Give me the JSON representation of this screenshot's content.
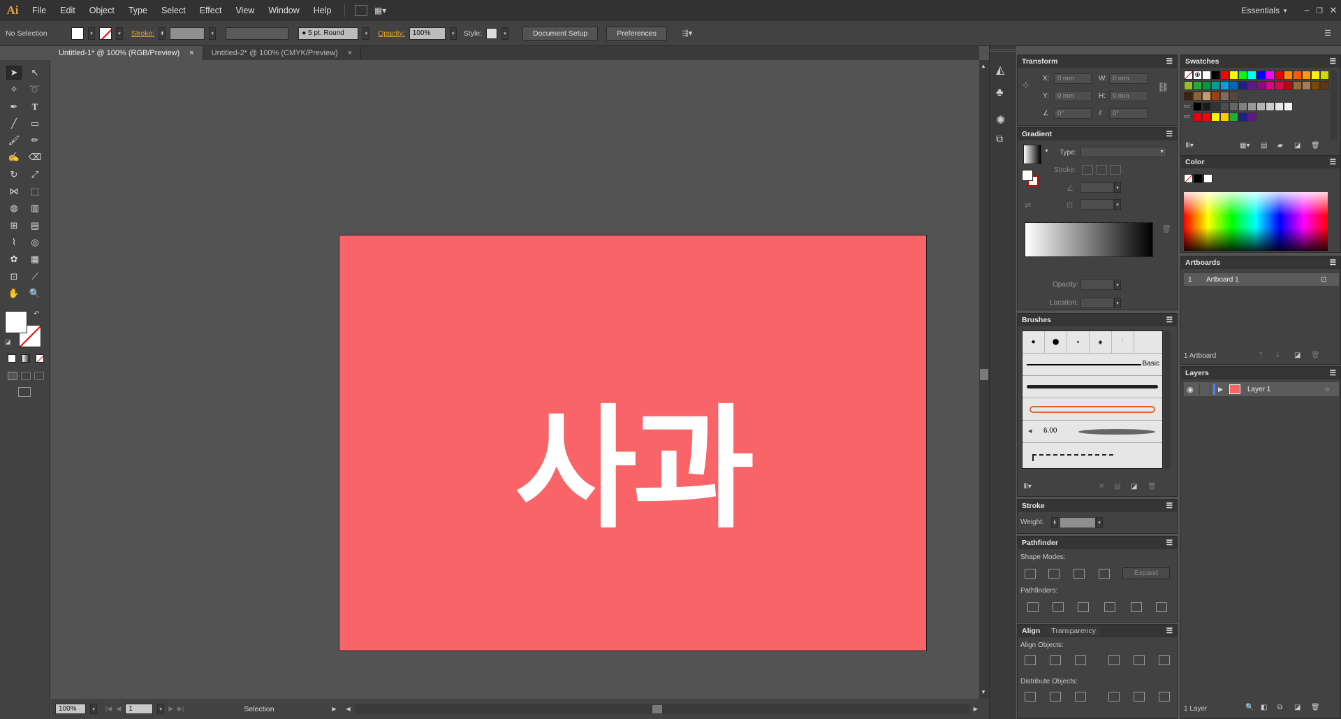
{
  "app": {
    "logo": "Ai",
    "menus": [
      "File",
      "Edit",
      "Object",
      "Type",
      "Select",
      "Effect",
      "View",
      "Window",
      "Help"
    ],
    "workspace": "Essentials",
    "window_controls": [
      "minimize",
      "restore",
      "close"
    ]
  },
  "control_bar": {
    "selection": "No Selection",
    "stroke_label": "Stroke:",
    "brush": "5 pt. Round",
    "opacity_label": "Opacity:",
    "opacity_value": "100%",
    "style_label": "Style:",
    "document_setup": "Document Setup",
    "preferences": "Preferences"
  },
  "tabs": [
    {
      "label": "Untitled-1* @ 100% (RGB/Preview)",
      "active": true,
      "close": "×"
    },
    {
      "label": "Untitled-2* @ 100% (CMYK/Preview)",
      "active": false,
      "close": "×"
    }
  ],
  "artboard": {
    "text": "사과",
    "color": "#f86467"
  },
  "status": {
    "zoom": "100%",
    "page": "1",
    "tool": "Selection"
  },
  "panels": {
    "transform": {
      "title": "Transform",
      "x_label": "X:",
      "y_label": "Y:",
      "w_label": "W:",
      "h_label": "H:",
      "x": "0 mm",
      "y": "0 mm",
      "w": "0 mm",
      "h": "0 mm",
      "angle": "0°",
      "shear": "0°"
    },
    "gradient": {
      "title": "Gradient",
      "type_label": "Type:",
      "stroke_label": "Stroke:",
      "opacity_label": "Opacity:",
      "location_label": "Location:"
    },
    "brushes": {
      "title": "Brushes",
      "basic_label": "Basic",
      "size_value": "6.00"
    },
    "stroke": {
      "title": "Stroke",
      "weight_label": "Weight:"
    },
    "pathfinder": {
      "title": "Pathfinder",
      "shape_modes": "Shape Modes:",
      "pathfinders": "Pathfinders:",
      "expand": "Expand"
    },
    "align": {
      "title": "Align",
      "transparency_tab": "Transparency",
      "align_objects": "Align Objects:",
      "distribute_objects": "Distribute Objects:"
    },
    "swatches": {
      "title": "Swatches"
    },
    "color": {
      "title": "Color"
    },
    "artboards": {
      "title": "Artboards",
      "row_num": "1",
      "row_name": "Artboard 1",
      "footer": "1 Artboard"
    },
    "layers": {
      "title": "Layers",
      "layer_name": "Layer 1",
      "footer": "1 Layer"
    }
  },
  "swatch_colors": [
    "#ffffff",
    "#000000",
    "#ff0000",
    "#ffff00",
    "#00ff00",
    "#00ffff",
    "#0000ff",
    "#ff00ff",
    "#e60012",
    "#ff8c00",
    "#ff5a00",
    "#ff9900",
    "#fff100",
    "#cfdb00",
    "#8fc31f",
    "#22ac38",
    "#009944",
    "#009e96",
    "#00a0e9",
    "#0068b7",
    "#1d2088",
    "#601986",
    "#920783",
    "#e4007f",
    "#e5004f",
    "#c7000b",
    "#996c33",
    "#a67c52",
    "#7d4900",
    "#603813",
    "#42210b",
    "#8c6239",
    "#c69c6d",
    "#a0410d",
    "#7e6b5a",
    "#534741"
  ]
}
